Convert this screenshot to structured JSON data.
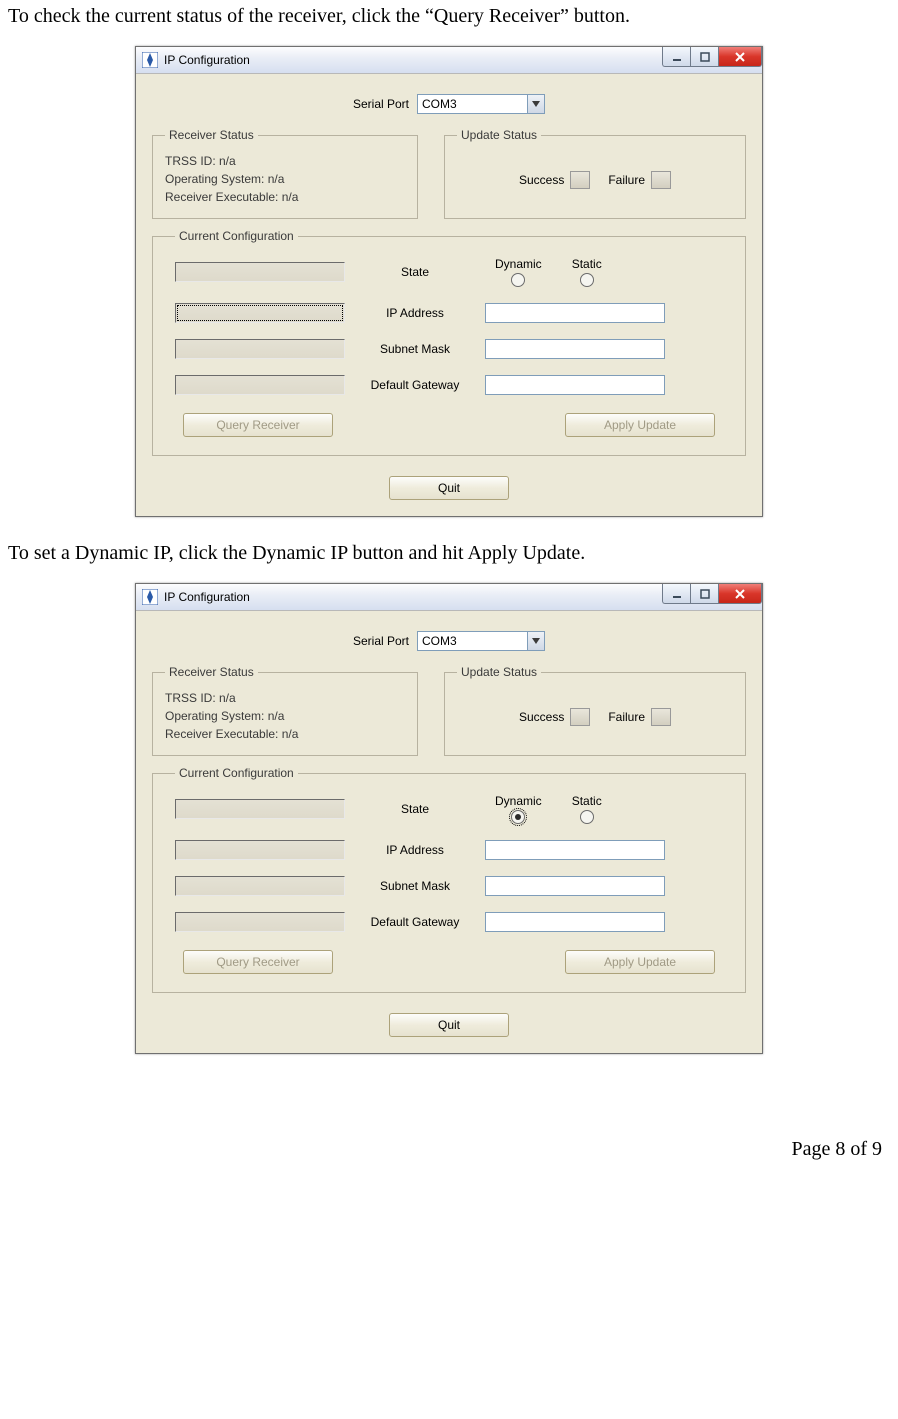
{
  "doc": {
    "instr1": "To check the current status of the receiver, click the “Query Receiver” button.",
    "instr2": "To set a Dynamic IP, click the Dynamic IP button and hit Apply Update.",
    "page_footer": "Page 8 of 9"
  },
  "win_common": {
    "title": "IP Configuration",
    "serial_port_label": "Serial Port",
    "serial_port_value": "COM3",
    "receiver_status_legend": "Receiver Status",
    "trss_id": "TRSS ID: n/a",
    "os": "Operating System: n/a",
    "exec": "Receiver Executable: n/a",
    "update_status_legend": "Update Status",
    "success_label": "Success",
    "failure_label": "Failure",
    "current_config_legend": "Current Configuration",
    "state_label": "State",
    "dynamic_label": "Dynamic",
    "static_label": "Static",
    "ip_label": "IP Address",
    "subnet_label": "Subnet Mask",
    "gateway_label": "Default Gateway",
    "query_btn": "Query Receiver",
    "apply_btn": "Apply Update",
    "quit_btn": "Quit"
  },
  "screens": [
    {
      "ip_address_selected": true,
      "dynamic_selected": false
    },
    {
      "ip_address_selected": false,
      "dynamic_selected": true
    }
  ]
}
